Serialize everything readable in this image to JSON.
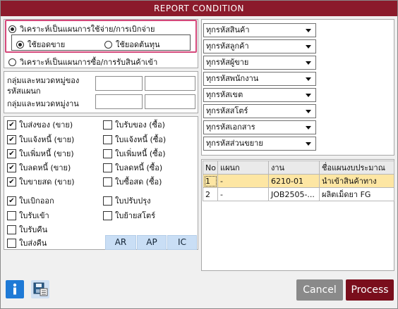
{
  "window": {
    "title": "REPORT CONDITION"
  },
  "analysis": {
    "option_expense": "วิเคราะห์เป็นแผนการใช้จ่าย/การเบิกจ่าย",
    "sub_sales": "ใช้ยอดขาย",
    "sub_cost": "ใช้ยอดต้นทุน",
    "option_purchase": "วิเคราะห์เป็นแผนการซื้อ/การรับสินค้าเข้า"
  },
  "groups": {
    "department_label_1": "กลุ่มและหมวดหมู่ของ",
    "department_label_2": "รหัสแผนก",
    "job_label": "กลุ่มและหมวดหมู่งาน"
  },
  "documents": {
    "left": [
      {
        "label": "ใบส่งของ (ขาย)",
        "checked": true
      },
      {
        "label": "ใบแจ้งหนี้ (ขาย)",
        "checked": true
      },
      {
        "label": "ใบเพิ่มหนี้ (ขาย)",
        "checked": true
      },
      {
        "label": "ใบลดหนี้ (ขาย)",
        "checked": true
      },
      {
        "label": "ใบขายสด (ขาย)",
        "checked": true
      },
      {
        "label": "ใบเบิกออก",
        "checked": true
      },
      {
        "label": "ใบรับเข้า",
        "checked": false
      },
      {
        "label": "ใบรับคืน",
        "checked": false
      },
      {
        "label": "ใบส่งคืน",
        "checked": false
      }
    ],
    "right": [
      {
        "label": "ใบรับของ (ซื้อ)",
        "checked": false
      },
      {
        "label": "ใบแจ้งหนี้ (ซื้อ)",
        "checked": false
      },
      {
        "label": "ใบเพิ่มหนี้ (ซื้อ)",
        "checked": false
      },
      {
        "label": "ใบลดหนี้ (ซื้อ)",
        "checked": false
      },
      {
        "label": "ใบซื้อสด (ซื้อ)",
        "checked": false
      },
      {
        "label": "ใบปรับปรุง",
        "checked": false
      },
      {
        "label": "ใบย้ายสโตร์",
        "checked": false
      }
    ],
    "buttons": [
      "AR",
      "AP",
      "IC"
    ]
  },
  "filters": [
    "ทุกรหัสสินค้า",
    "ทุกรหัสลูกค้า",
    "ทุกรหัสผู้ขาย",
    "ทุกรหัสพนักงาน",
    "ทุกรหัสเขต",
    "ทุกรหัสสโตร์",
    "ทุกรหัสเอกสาร",
    "ทุกรหัสส่วนขยาย"
  ],
  "grid": {
    "headers": [
      "No",
      "แผนก",
      "งาน",
      "ชื่อแผนงบประมาณ"
    ],
    "rows": [
      [
        "1",
        "-",
        "6210-01",
        "นำเข้าสินค้าทาง"
      ],
      [
        "2",
        "-",
        "JOB2505-...",
        "ผลิตเม็ดยา FG"
      ]
    ]
  },
  "footer": {
    "cancel": "Cancel",
    "process": "Process"
  },
  "colors": {
    "title_bar": "#8b1a2b",
    "highlight": "#d4487a",
    "process_button": "#7a0e1c",
    "cancel_button": "#8a8a8a",
    "selected_row": "#fde6a3",
    "mini_button": "#c9def5",
    "info_button": "#1f7ad6"
  },
  "icons": [
    "info-icon",
    "save-settings-icon",
    "dropdown-arrow-icon",
    "check-icon"
  ]
}
